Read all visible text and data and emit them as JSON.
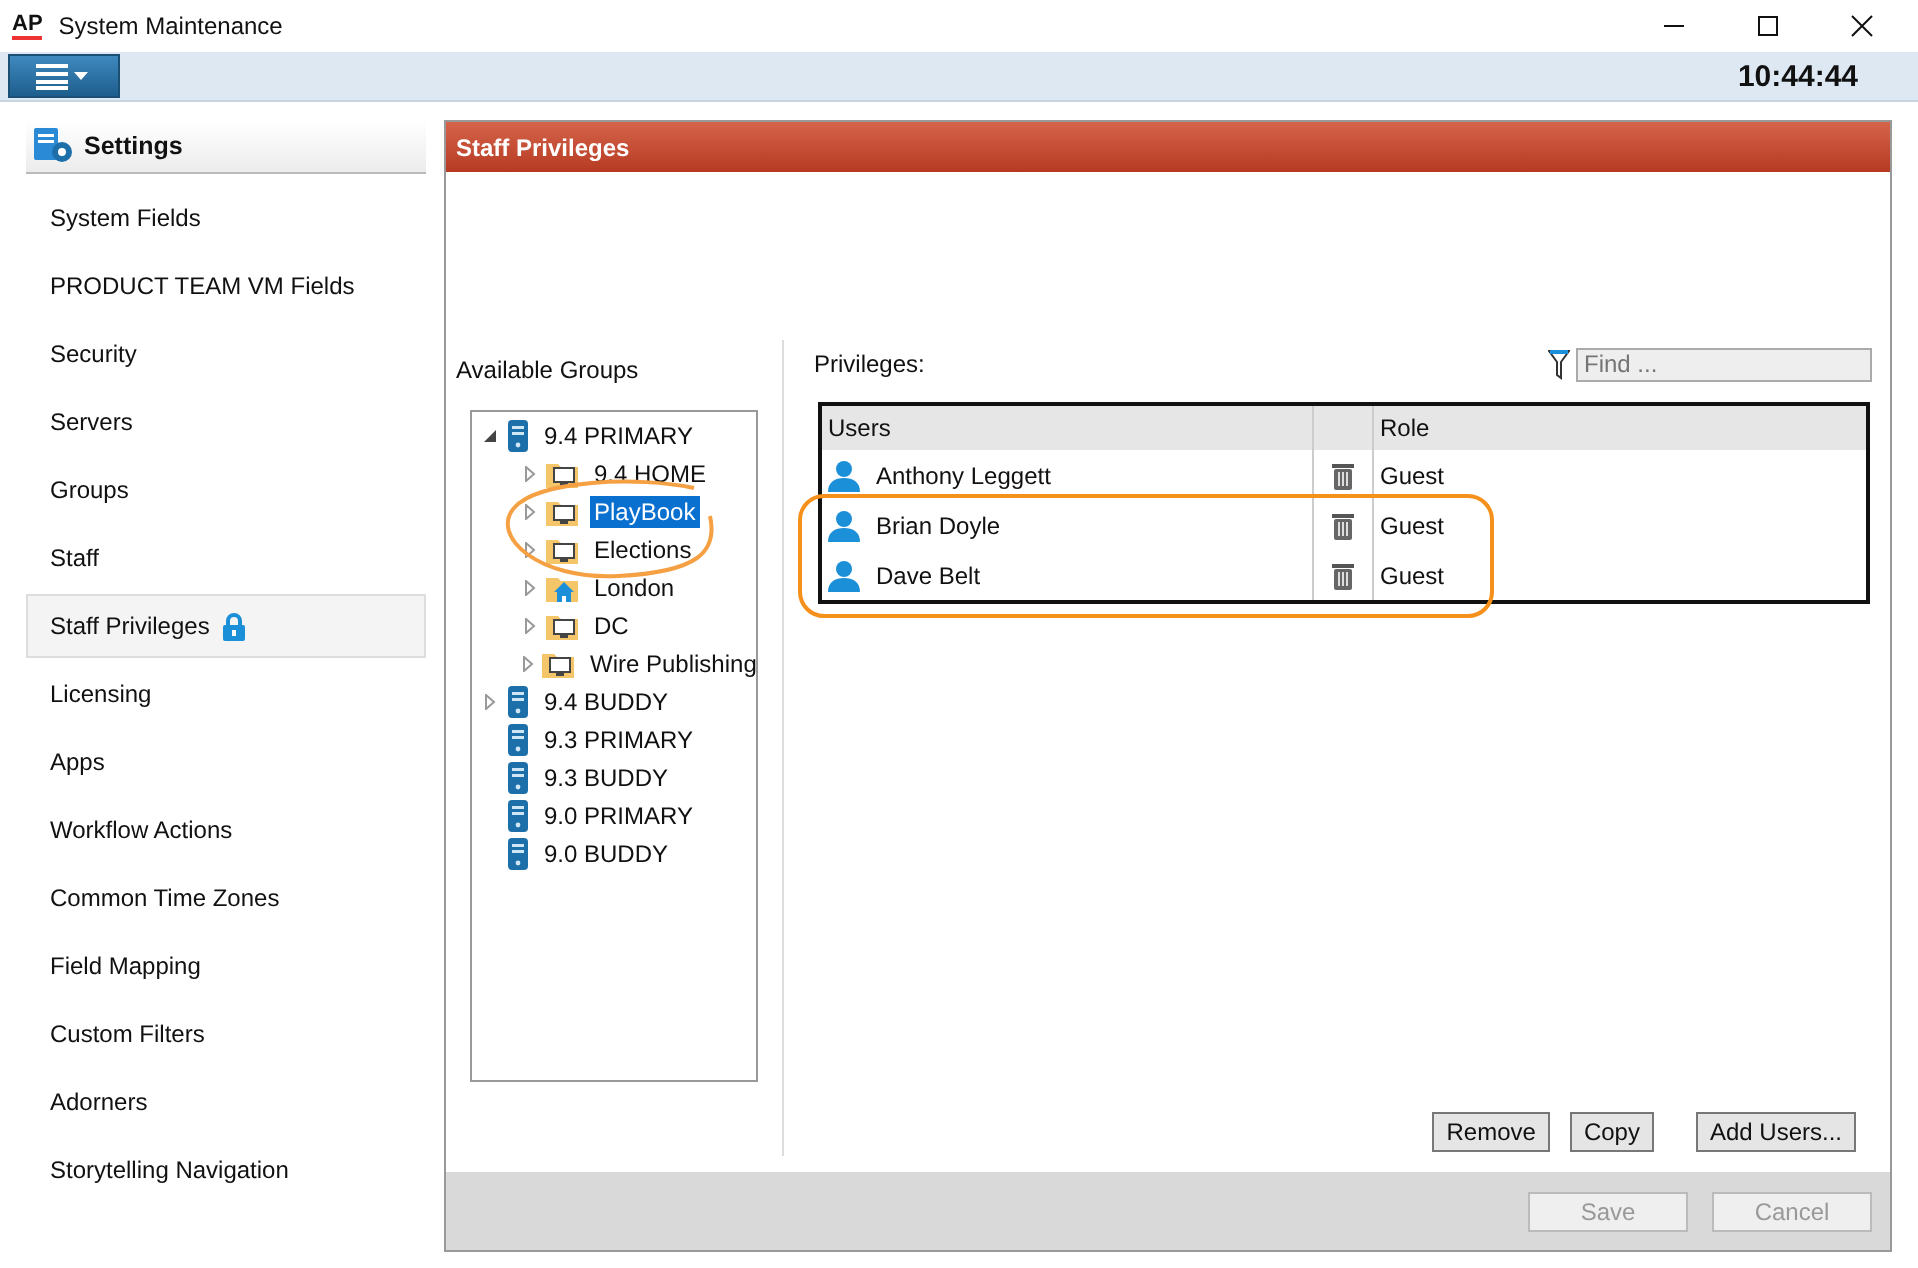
{
  "window": {
    "logo": "AP",
    "title": "System Maintenance"
  },
  "toolbar": {
    "clock": "10:44:44"
  },
  "sidebar": {
    "title": "Settings",
    "items": [
      {
        "label": "System Fields",
        "selected": false,
        "locked": false
      },
      {
        "label": "PRODUCT TEAM VM Fields",
        "selected": false,
        "locked": false
      },
      {
        "label": "Security",
        "selected": false,
        "locked": false
      },
      {
        "label": "Servers",
        "selected": false,
        "locked": false
      },
      {
        "label": "Groups",
        "selected": false,
        "locked": false
      },
      {
        "label": "Staff",
        "selected": false,
        "locked": false
      },
      {
        "label": "Staff Privileges",
        "selected": true,
        "locked": true
      },
      {
        "label": "Licensing",
        "selected": false,
        "locked": false
      },
      {
        "label": "Apps",
        "selected": false,
        "locked": false
      },
      {
        "label": "Workflow Actions",
        "selected": false,
        "locked": false
      },
      {
        "label": "Common Time Zones",
        "selected": false,
        "locked": false
      },
      {
        "label": "Field Mapping",
        "selected": false,
        "locked": false
      },
      {
        "label": "Custom Filters",
        "selected": false,
        "locked": false
      },
      {
        "label": "Adorners",
        "selected": false,
        "locked": false
      },
      {
        "label": "Storytelling Navigation",
        "selected": false,
        "locked": false
      }
    ]
  },
  "panel": {
    "title": "Staff Privileges",
    "groups": {
      "label": "Available Groups",
      "tree": [
        {
          "label": "9.4 PRIMARY",
          "kind": "server",
          "expandable": true,
          "expanded": true,
          "selected": false,
          "children": [
            {
              "label": "9.4 HOME",
              "kind": "folder",
              "expandable": true,
              "expanded": false,
              "selected": false
            },
            {
              "label": "PlayBook",
              "kind": "folder",
              "expandable": true,
              "expanded": false,
              "selected": true
            },
            {
              "label": "Elections",
              "kind": "folder",
              "expandable": true,
              "expanded": false,
              "selected": false
            },
            {
              "label": "London",
              "kind": "home-folder",
              "expandable": true,
              "expanded": false,
              "selected": false
            },
            {
              "label": "DC",
              "kind": "folder",
              "expandable": true,
              "expanded": false,
              "selected": false
            },
            {
              "label": "Wire Publishing",
              "kind": "folder",
              "expandable": true,
              "expanded": false,
              "selected": false
            }
          ]
        },
        {
          "label": "9.4 BUDDY",
          "kind": "server",
          "expandable": true,
          "expanded": false,
          "selected": false
        },
        {
          "label": "9.3 PRIMARY",
          "kind": "server",
          "expandable": false,
          "selected": false
        },
        {
          "label": "9.3 BUDDY",
          "kind": "server",
          "expandable": false,
          "selected": false
        },
        {
          "label": "9.0 PRIMARY",
          "kind": "server",
          "expandable": false,
          "selected": false
        },
        {
          "label": "9.0 BUDDY",
          "kind": "server",
          "expandable": false,
          "selected": false
        }
      ]
    },
    "privileges": {
      "label": "Privileges:",
      "search": {
        "placeholder": "Find ..."
      },
      "columns": [
        "Users",
        "Role"
      ],
      "rows": [
        {
          "user": "Anthony Leggett",
          "role": "Guest"
        },
        {
          "user": "Brian Doyle",
          "role": "Guest"
        },
        {
          "user": "Dave Belt",
          "role": "Guest"
        }
      ],
      "buttons": [
        "Remove",
        "Copy",
        "Add Users..."
      ]
    },
    "footer_buttons": [
      {
        "label": "Save",
        "disabled": true
      },
      {
        "label": "Cancel",
        "disabled": true
      }
    ]
  }
}
